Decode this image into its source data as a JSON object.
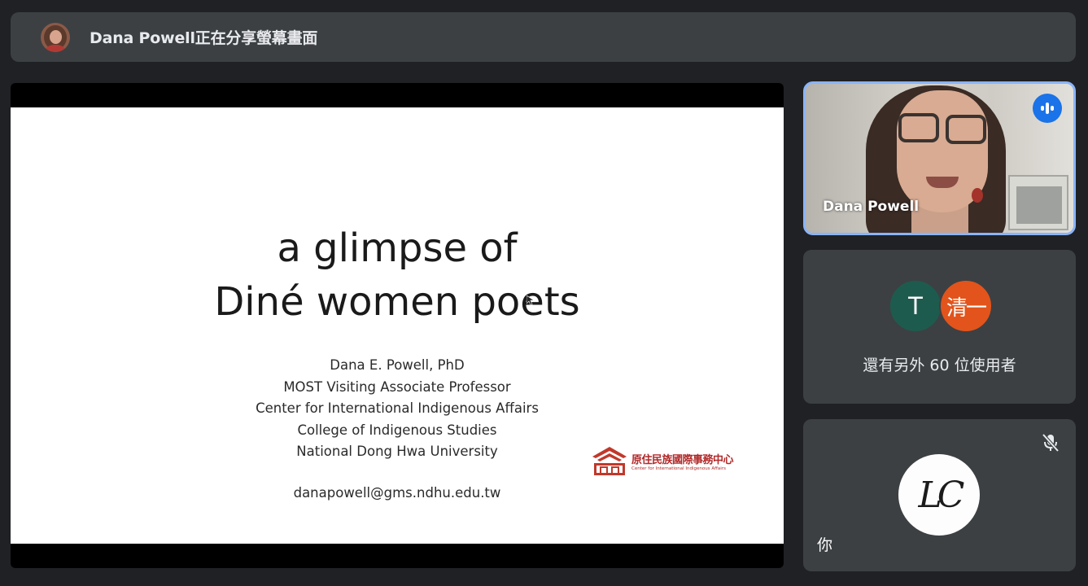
{
  "banner": {
    "presenter_avatar": "presenter-avatar",
    "text": "Dana Powell正在分享螢幕畫面"
  },
  "slide": {
    "title_line1": "a glimpse of",
    "title_line2": "Diné women poets",
    "info": [
      "Dana E. Powell, PhD",
      "MOST Visiting Associate Professor",
      "Center for International Indigenous Affairs",
      "College of Indigenous Studies",
      "National Dong Hwa University"
    ],
    "email": "danapowell@gms.ndhu.edu.tw",
    "logo": {
      "zh": "原住民族國際事務中心",
      "en": "Center for International Indigenous Affairs"
    }
  },
  "speaker_tile": {
    "name": "Dana Powell",
    "icon": "speaking-indicator-icon",
    "accent": "#8ab4f8"
  },
  "others_tile": {
    "avatars": [
      {
        "label": "T",
        "color": "#1e5b4f"
      },
      {
        "label": "清一",
        "color": "#e2541b"
      }
    ],
    "text": "還有另外 60 位使用者"
  },
  "self_tile": {
    "avatar_text": "LC",
    "label": "你",
    "icon": "mic-off-icon"
  }
}
